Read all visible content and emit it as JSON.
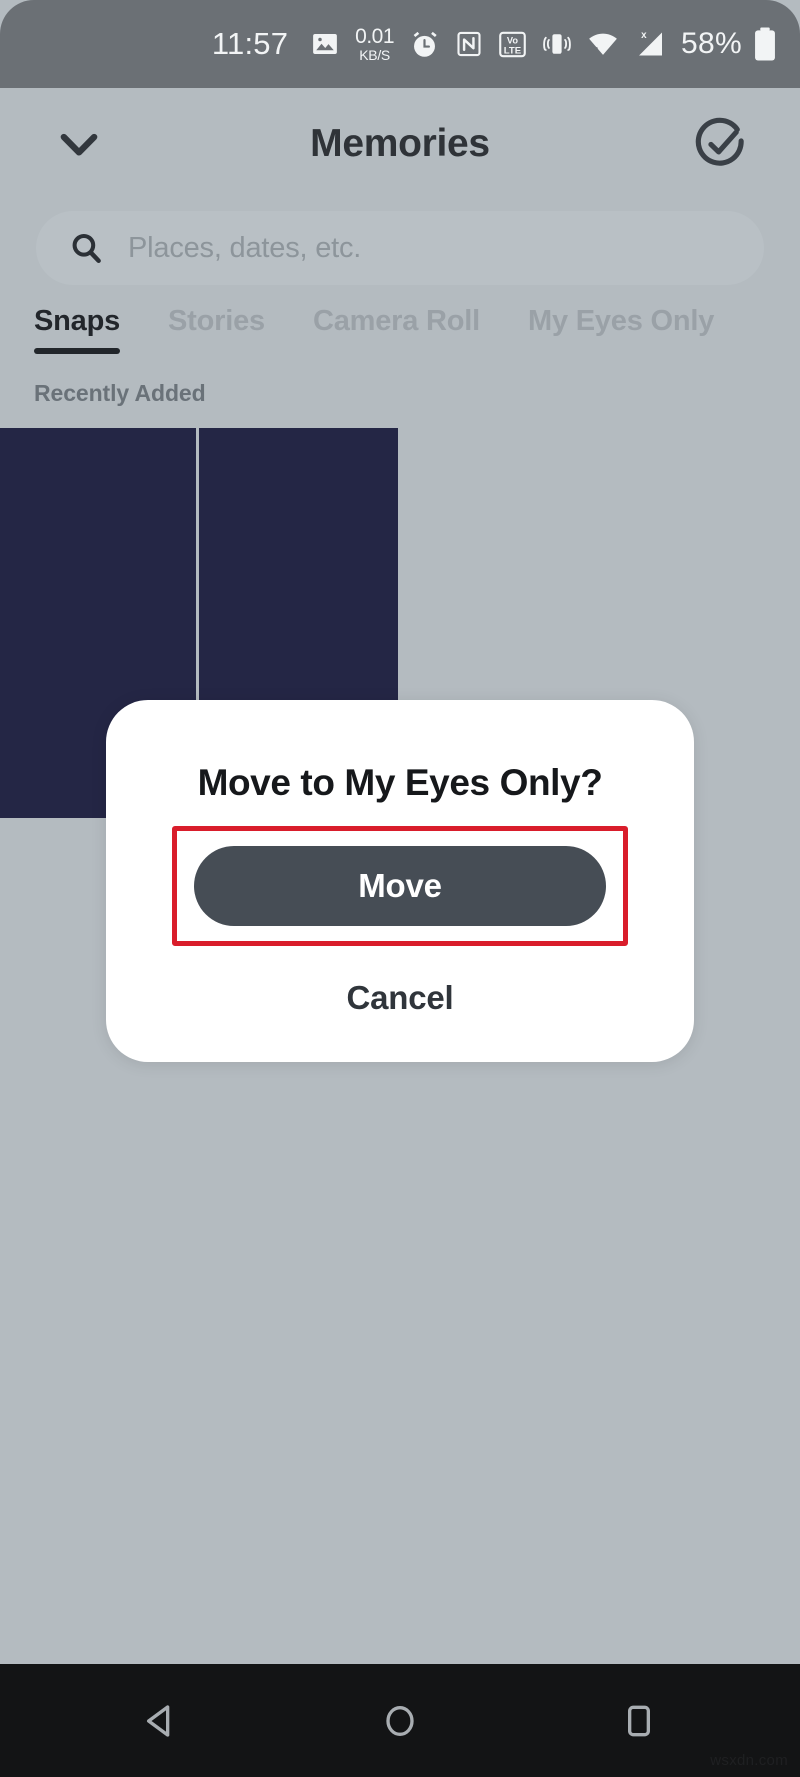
{
  "status_bar": {
    "time": "11:57",
    "network_speed_value": "0.01",
    "network_speed_unit": "KB/S",
    "battery_percent": "58%",
    "icons": [
      "image-icon",
      "network-speed-icon",
      "alarm-clock-icon",
      "nfc-icon",
      "volte-icon",
      "vibrate-icon",
      "wifi-icon",
      "cellular-signal-no-sim-icon",
      "battery-icon"
    ],
    "colors": {
      "background": "#6b7075",
      "foreground": "#f2f4f5"
    }
  },
  "header": {
    "title": "Memories",
    "back_icon": "chevron-down-icon",
    "select_icon": "check-circle-icon"
  },
  "search": {
    "placeholder": "Places, dates, etc.",
    "icon": "search-icon"
  },
  "tabs": [
    {
      "label": "Snaps",
      "active": true
    },
    {
      "label": "Stories",
      "active": false
    },
    {
      "label": "Camera Roll",
      "active": false
    },
    {
      "label": "My Eyes Only",
      "active": false
    }
  ],
  "content": {
    "section_label": "Recently Added",
    "thumbnail_color": "#242645",
    "thumbnail_count": 2
  },
  "dialog": {
    "title": "Move to My Eyes Only?",
    "primary_button": "Move",
    "secondary_button": "Cancel",
    "highlight_color": "#d91d2b",
    "primary_button_color": "#464d55"
  },
  "nav_bar": {
    "back": "back-triangle-icon",
    "home": "home-circle-icon",
    "recents": "recents-square-icon"
  },
  "watermark": {
    "text": "wsxdn.com"
  }
}
